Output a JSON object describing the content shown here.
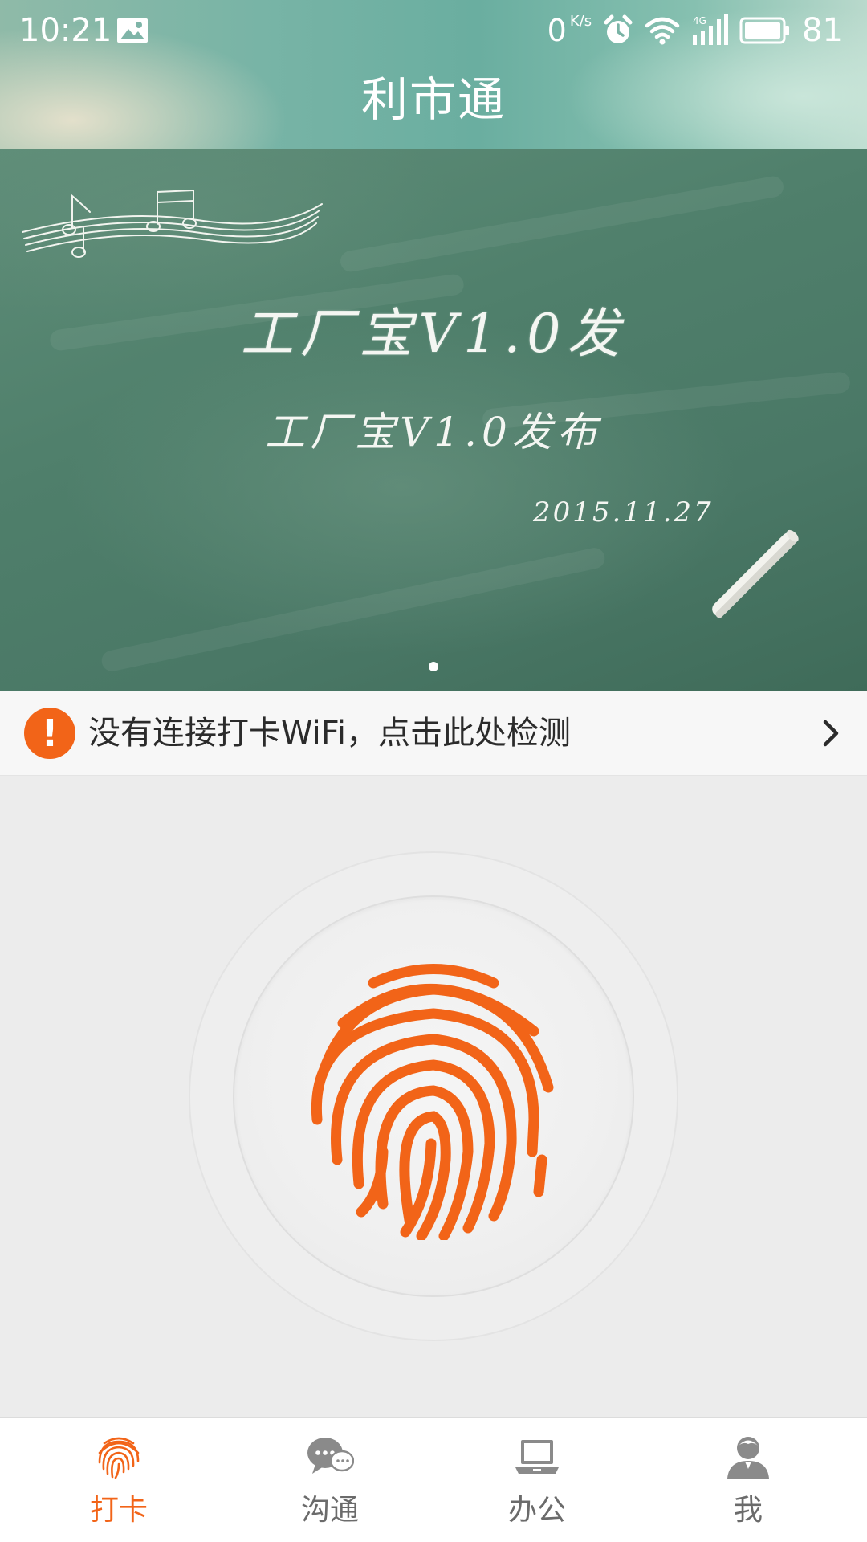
{
  "status_bar": {
    "time": "10:21",
    "speed_value": "0",
    "speed_unit": "K/s",
    "network_label": "4G",
    "battery": "81"
  },
  "header": {
    "title": "利市通"
  },
  "banner": {
    "line1": "工厂宝V1.0发",
    "line2": "工厂宝V1.0发布",
    "date": "2015.11.27",
    "page_count": 1,
    "active_page": 1
  },
  "notice": {
    "icon_text": "!",
    "text": "没有连接打卡WiFi，点击此处检测"
  },
  "tabs": [
    {
      "label": "打卡",
      "icon": "fingerprint-icon",
      "active": true
    },
    {
      "label": "沟通",
      "icon": "chat-icon",
      "active": false
    },
    {
      "label": "办公",
      "icon": "laptop-icon",
      "active": false
    },
    {
      "label": "我",
      "icon": "user-icon",
      "active": false
    }
  ],
  "colors": {
    "accent": "#f26418",
    "tab_inactive": "#6b6b6b",
    "banner_chalkboard": "#4f7f6b",
    "header_teal": "#6aaea0"
  }
}
